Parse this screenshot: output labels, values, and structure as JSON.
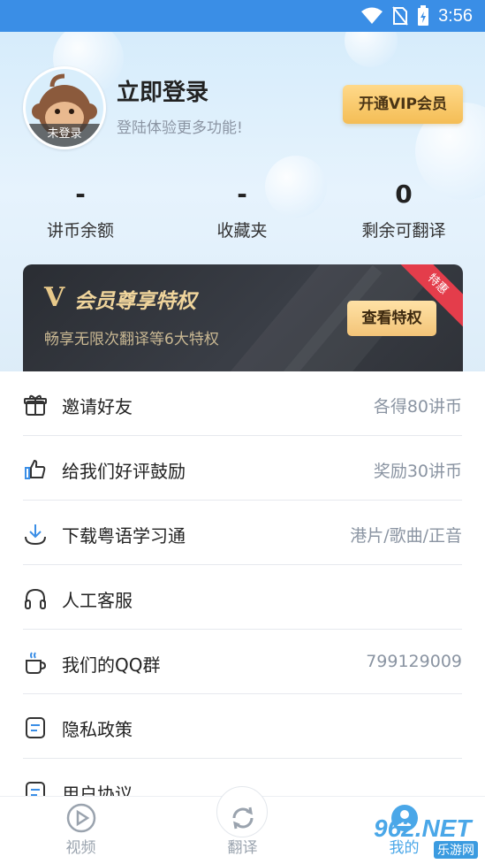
{
  "status_bar": {
    "time": "3:56"
  },
  "profile": {
    "avatar_badge": "未登录",
    "title": "立即登录",
    "subtitle": "登陆体验更多功能!",
    "vip_button": "开通VIP会员"
  },
  "stats": [
    {
      "value": "-",
      "label": "讲币余额"
    },
    {
      "value": "-",
      "label": "收藏夹"
    },
    {
      "value": "0",
      "label": "剩余可翻译"
    }
  ],
  "vip_card": {
    "mark": "V",
    "title": "会员尊享特权",
    "description": "畅享无限次翻译等6大特权",
    "button": "查看特权",
    "ribbon": "特惠"
  },
  "menu": [
    {
      "icon": "gift-icon",
      "label": "邀请好友",
      "value": "各得80讲币"
    },
    {
      "icon": "thumbs-up-icon",
      "label": "给我们好评鼓励",
      "value": "奖励30讲币"
    },
    {
      "icon": "download-icon",
      "label": "下载粤语学习通",
      "value": "港片/歌曲/正音"
    },
    {
      "icon": "headphones-icon",
      "label": "人工客服",
      "value": ""
    },
    {
      "icon": "coffee-cup-icon",
      "label": "我们的QQ群",
      "value": "799129009"
    },
    {
      "icon": "document-icon",
      "label": "隐私政策",
      "value": ""
    },
    {
      "icon": "document-icon",
      "label": "用户协议",
      "value": ""
    }
  ],
  "tabs": [
    {
      "icon": "play-circle-icon",
      "label": "视频"
    },
    {
      "icon": "refresh-icon",
      "label": "翻译"
    },
    {
      "icon": "profile-icon",
      "label": "我的"
    }
  ],
  "watermark": {
    "main": "962.NET",
    "sub": "乐游网"
  },
  "colors": {
    "status_bar": "#3a8ee6",
    "vip_gold": "#f4bd55",
    "accent_blue": "#4aa7e8"
  }
}
